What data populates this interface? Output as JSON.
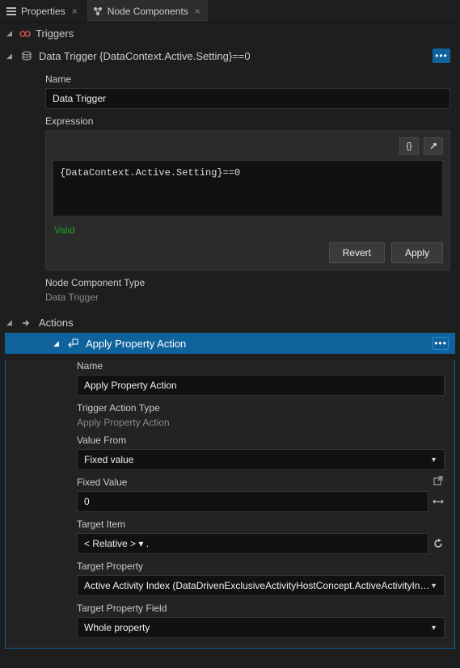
{
  "tabs": [
    {
      "label": "Properties"
    },
    {
      "label": "Node Components"
    }
  ],
  "triggers": {
    "header": "Triggers",
    "data_trigger": {
      "title": "Data Trigger {DataContext.Active.Setting}==0",
      "name_label": "Name",
      "name_value": "Data Trigger",
      "expression_label": "Expression",
      "expression_value": "{DataContext.Active.Setting}==0",
      "valid": "Valid",
      "revert": "Revert",
      "apply": "Apply",
      "nct_label": "Node Component Type",
      "nct_value": "Data Trigger"
    }
  },
  "actions": {
    "header": "Actions",
    "apa": {
      "title": "Apply Property Action",
      "name_label": "Name",
      "name_value": "Apply Property Action",
      "tat_label": "Trigger Action Type",
      "tat_value": "Apply Property Action",
      "value_from_label": "Value From",
      "value_from_value": "Fixed value",
      "fixed_value_label": "Fixed Value",
      "fixed_value_value": "0",
      "target_item_label": "Target Item",
      "target_item_value": "< Relative > ▾  .",
      "target_property_label": "Target Property",
      "target_property_value": "Active Activity Index (DataDrivenExclusiveActivityHostConcept.ActiveActivityIndex)",
      "target_property_field_label": "Target Property Field",
      "target_property_field_value": "Whole property"
    }
  }
}
